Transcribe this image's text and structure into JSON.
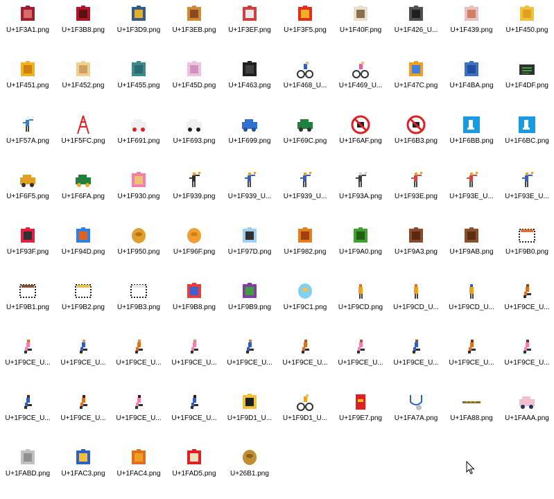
{
  "files": [
    {
      "label": "U+1F3A1.png",
      "icon": "ferris-wheel-icon",
      "colors": [
        "#9a2030",
        "#d86a6a"
      ]
    },
    {
      "label": "U+1F3B8.png",
      "icon": "guitar-icon",
      "colors": [
        "#b0182a",
        "#5a1010"
      ]
    },
    {
      "label": "U+1F3D9.png",
      "icon": "cityscape-icon",
      "colors": [
        "#3a5a80",
        "#e0b030"
      ]
    },
    {
      "label": "U+1F3EB.png",
      "icon": "school-icon",
      "colors": [
        "#d08a3a",
        "#8a4a20"
      ]
    },
    {
      "label": "U+1F3EF.png",
      "icon": "japanese-castle-icon",
      "colors": [
        "#d04040",
        "#e8e8e8"
      ]
    },
    {
      "label": "U+1F3F5.png",
      "icon": "rosette-icon",
      "colors": [
        "#e03020",
        "#f0b020"
      ]
    },
    {
      "label": "U+1F40F.png",
      "icon": "ram-icon",
      "colors": [
        "#e8e0c8",
        "#8a7050"
      ]
    },
    {
      "label": "U+1F426_U...",
      "icon": "bird-icon",
      "colors": [
        "#505050",
        "#202020"
      ]
    },
    {
      "label": "U+1F439.png",
      "icon": "hamster-icon",
      "colors": [
        "#e8c0c0",
        "#d08060"
      ]
    },
    {
      "label": "U+1F450.png",
      "icon": "open-hands-icon",
      "colors": [
        "#f0c040",
        "#e0a020"
      ]
    },
    {
      "label": "U+1F451.png",
      "icon": "crown-icon",
      "colors": [
        "#f0b020",
        "#d08010"
      ]
    },
    {
      "label": "U+1F452.png",
      "icon": "womans-hat-icon",
      "colors": [
        "#f0d090",
        "#d0a060"
      ]
    },
    {
      "label": "U+1F455.png",
      "icon": "t-shirt-icon",
      "colors": [
        "#3a8a90",
        "#2a6a70"
      ]
    },
    {
      "label": "U+1F45D.png",
      "icon": "pouch-icon",
      "colors": [
        "#f0c0e0",
        "#d090c0"
      ]
    },
    {
      "label": "U+1F463.png",
      "icon": "footprints-icon",
      "colors": [
        "#202020",
        "#404040"
      ]
    },
    {
      "label": "U+1F468_U...",
      "icon": "man-cyclist-icon",
      "colors": [
        "#3060c0",
        "#303030"
      ]
    },
    {
      "label": "U+1F469_U...",
      "icon": "woman-cyclist-icon",
      "colors": [
        "#e060a0",
        "#303030"
      ]
    },
    {
      "label": "U+1F47C.png",
      "icon": "baby-angel-icon",
      "colors": [
        "#f0a020",
        "#4080e0"
      ]
    },
    {
      "label": "U+1F4BA.png",
      "icon": "seat-icon",
      "colors": [
        "#4070c0",
        "#2050a0"
      ]
    },
    {
      "label": "U+1F4DF.png",
      "icon": "pager-icon",
      "colors": [
        "#303030",
        "#40a040"
      ]
    },
    {
      "label": "U+1F57A.png",
      "icon": "man-dancing-icon",
      "colors": [
        "#f0f0f0",
        "#3080d0"
      ]
    },
    {
      "label": "U+1F5FC.png",
      "icon": "tokyo-tower-icon",
      "colors": [
        "#e02020",
        "#f0f0f0"
      ]
    },
    {
      "label": "U+1F691.png",
      "icon": "ambulance-icon",
      "colors": [
        "#f0f0f0",
        "#e02020"
      ]
    },
    {
      "label": "U+1F693.png",
      "icon": "police-car-icon",
      "colors": [
        "#f0f0f0",
        "#202020"
      ]
    },
    {
      "label": "U+1F699.png",
      "icon": "suv-icon",
      "colors": [
        "#3070d0",
        "#2050a0"
      ]
    },
    {
      "label": "U+1F69C.png",
      "icon": "tractor-icon",
      "colors": [
        "#208040",
        "#303030"
      ]
    },
    {
      "label": "U+1F6AF.png",
      "icon": "no-littering-icon",
      "colors": [
        "#e02020",
        "#202020"
      ]
    },
    {
      "label": "U+1F6B3.png",
      "icon": "no-bicycles-icon",
      "colors": [
        "#e02020",
        "#202020"
      ]
    },
    {
      "label": "U+1F6BB.png",
      "icon": "restroom-icon",
      "colors": [
        "#1a9ae0",
        "#ffffff"
      ]
    },
    {
      "label": "U+1F6BC.png",
      "icon": "baby-symbol-icon",
      "colors": [
        "#1a9ae0",
        "#ffffff"
      ]
    },
    {
      "label": "U+1F6F5.png",
      "icon": "motor-scooter-icon",
      "colors": [
        "#e0a020",
        "#303030"
      ]
    },
    {
      "label": "U+1F6FA.png",
      "icon": "auto-rickshaw-icon",
      "colors": [
        "#208040",
        "#e0b020"
      ]
    },
    {
      "label": "U+1F930.png",
      "icon": "pregnant-woman-icon",
      "colors": [
        "#f080b0",
        "#f0c070"
      ]
    },
    {
      "label": "U+1F939.png",
      "icon": "person-juggling-icon",
      "colors": [
        "#f0a020",
        "#303030"
      ]
    },
    {
      "label": "U+1F939_U...",
      "icon": "man-juggling-icon",
      "colors": [
        "#f0a020",
        "#3060c0"
      ]
    },
    {
      "label": "U+1F939_U...",
      "icon": "woman-juggling-icon",
      "colors": [
        "#f0a020",
        "#3060c0"
      ]
    },
    {
      "label": "U+1F93A.png",
      "icon": "person-fencing-icon",
      "colors": [
        "#d0d0d0",
        "#404040"
      ]
    },
    {
      "label": "U+1F93E.png",
      "icon": "person-handball-icon",
      "colors": [
        "#f0a020",
        "#e04040"
      ]
    },
    {
      "label": "U+1F93E_U...",
      "icon": "man-handball-icon",
      "colors": [
        "#f0a020",
        "#e04040"
      ]
    },
    {
      "label": "U+1F93E_U...",
      "icon": "woman-handball-icon",
      "colors": [
        "#f0a020",
        "#3060c0"
      ]
    },
    {
      "label": "U+1F93F.png",
      "icon": "diving-mask-icon",
      "colors": [
        "#e02040",
        "#303030"
      ]
    },
    {
      "label": "U+1F94D.png",
      "icon": "lacrosse-icon",
      "colors": [
        "#3080e0",
        "#e06020"
      ]
    },
    {
      "label": "U+1F950.png",
      "icon": "croissant-icon",
      "colors": [
        "#e0a030",
        "#c07010"
      ]
    },
    {
      "label": "U+1F96F.png",
      "icon": "bagel-icon",
      "colors": [
        "#f0a030",
        "#d08010"
      ]
    },
    {
      "label": "U+1F97D.png",
      "icon": "goggles-icon",
      "colors": [
        "#a0d0f0",
        "#303030"
      ]
    },
    {
      "label": "U+1F982.png",
      "icon": "scorpion-icon",
      "colors": [
        "#e08020",
        "#a04010"
      ]
    },
    {
      "label": "U+1F9A0.png",
      "icon": "microbe-icon",
      "colors": [
        "#40a030",
        "#206010"
      ]
    },
    {
      "label": "U+1F9A3.png",
      "icon": "mammoth-icon",
      "colors": [
        "#8a4a30",
        "#5a2a10"
      ]
    },
    {
      "label": "U+1F9AB.png",
      "icon": "beaver-icon",
      "colors": [
        "#8a5030",
        "#5a3010"
      ]
    },
    {
      "label": "U+1F9B0.png",
      "icon": "red-hair-icon",
      "colors": [
        "#e07030",
        "#202020"
      ]
    },
    {
      "label": "U+1F9B1.png",
      "icon": "curly-hair-icon",
      "colors": [
        "#8a5030",
        "#202020"
      ]
    },
    {
      "label": "U+1F9B2.png",
      "icon": "bald-icon",
      "colors": [
        "#f0c040",
        "#202020"
      ]
    },
    {
      "label": "U+1F9B3.png",
      "icon": "white-hair-icon",
      "colors": [
        "#e8e8e8",
        "#202020"
      ]
    },
    {
      "label": "U+1F9B8.png",
      "icon": "superhero-icon",
      "colors": [
        "#e04040",
        "#4060d0"
      ]
    },
    {
      "label": "U+1F9B9.png",
      "icon": "supervillain-icon",
      "colors": [
        "#8040a0",
        "#40a040"
      ]
    },
    {
      "label": "U+1F9C1.png",
      "icon": "cupcake-icon",
      "colors": [
        "#80d0f0",
        "#f0c060"
      ]
    },
    {
      "label": "U+1F9CD.png",
      "icon": "person-standing-icon",
      "colors": [
        "#f0a020",
        "#e07020"
      ]
    },
    {
      "label": "U+1F9CD_U...",
      "icon": "man-standing-icon",
      "colors": [
        "#f0a020",
        "#e07020"
      ]
    },
    {
      "label": "U+1F9CD_U...",
      "icon": "woman-standing-icon",
      "colors": [
        "#f0a020",
        "#3060c0"
      ]
    },
    {
      "label": "U+1F9CE_U...",
      "icon": "person-kneeling-icon",
      "colors": [
        "#e07020",
        "#8a4a20"
      ]
    },
    {
      "label": "U+1F9CE_U...",
      "icon": "person-kneeling-icon",
      "colors": [
        "#f080b0",
        "#e07020"
      ]
    },
    {
      "label": "U+1F9CE_U...",
      "icon": "person-kneeling-icon",
      "colors": [
        "#3060c0",
        "#e0a060"
      ]
    },
    {
      "label": "U+1F9CE_U...",
      "icon": "person-kneeling-icon",
      "colors": [
        "#e07020",
        "#d09060"
      ]
    },
    {
      "label": "U+1F9CE_U...",
      "icon": "person-kneeling-icon",
      "colors": [
        "#f080b0",
        "#d09060"
      ]
    },
    {
      "label": "U+1F9CE_U...",
      "icon": "person-kneeling-icon",
      "colors": [
        "#3060c0",
        "#c08050"
      ]
    },
    {
      "label": "U+1F9CE_U...",
      "icon": "person-kneeling-icon",
      "colors": [
        "#e07020",
        "#a06030"
      ]
    },
    {
      "label": "U+1F9CE_U...",
      "icon": "person-kneeling-icon",
      "colors": [
        "#f080b0",
        "#a06030"
      ]
    },
    {
      "label": "U+1F9CE_U...",
      "icon": "person-kneeling-icon",
      "colors": [
        "#3060c0",
        "#8a5030"
      ]
    },
    {
      "label": "U+1F9CE_U...",
      "icon": "person-kneeling-icon",
      "colors": [
        "#e07020",
        "#6a3a20"
      ]
    },
    {
      "label": "U+1F9CE_U...",
      "icon": "person-kneeling-icon",
      "colors": [
        "#f080b0",
        "#6a3a20"
      ]
    },
    {
      "label": "U+1F9CE_U...",
      "icon": "person-kneeling-icon",
      "colors": [
        "#3060c0",
        "#4a2a10"
      ]
    },
    {
      "label": "U+1F9CE_U...",
      "icon": "person-kneeling-icon",
      "colors": [
        "#e07020",
        "#3a2010"
      ]
    },
    {
      "label": "U+1F9CE_U...",
      "icon": "person-kneeling-icon",
      "colors": [
        "#f080b0",
        "#3a2010"
      ]
    },
    {
      "label": "U+1F9CE_U...",
      "icon": "person-kneeling-icon",
      "colors": [
        "#3060c0",
        "#2a1a10"
      ]
    },
    {
      "label": "U+1F9D1_U...",
      "icon": "graduate-icon",
      "colors": [
        "#f0c040",
        "#202020"
      ]
    },
    {
      "label": "U+1F9D1_U...",
      "icon": "cyclist-icon",
      "colors": [
        "#f0a020",
        "#303030"
      ]
    },
    {
      "label": "U+1F9E7.png",
      "icon": "red-envelope-icon",
      "colors": [
        "#e02020",
        "#f0c020"
      ]
    },
    {
      "label": "U+1FA7A.png",
      "icon": "stethoscope-icon",
      "colors": [
        "#3060d0",
        "#c0c0c0"
      ]
    },
    {
      "label": "U+1FA88.png",
      "icon": "flute-icon",
      "colors": [
        "#8a6a20",
        "#c0a040"
      ]
    },
    {
      "label": "U+1FAAA.png",
      "icon": "id-card-icon",
      "colors": [
        "#f0c0d0",
        "#203060"
      ]
    },
    {
      "label": "U+1FABD.png",
      "icon": "wing-icon",
      "colors": [
        "#c0c0c0",
        "#909090"
      ]
    },
    {
      "label": "U+1FAC3.png",
      "icon": "pregnant-man-icon",
      "colors": [
        "#3060c0",
        "#f0c040"
      ]
    },
    {
      "label": "U+1FAC4.png",
      "icon": "pregnant-person-icon",
      "colors": [
        "#e07020",
        "#f0a020"
      ]
    },
    {
      "label": "U+1FAD5.png",
      "icon": "fondue-icon",
      "colors": [
        "#e02020",
        "#f0e0c0"
      ]
    },
    {
      "label": "U+26B1.png",
      "icon": "funeral-urn-icon",
      "colors": [
        "#c09030",
        "#8a6020"
      ]
    }
  ],
  "cursor": {
    "icon": "mouse-pointer-icon"
  }
}
